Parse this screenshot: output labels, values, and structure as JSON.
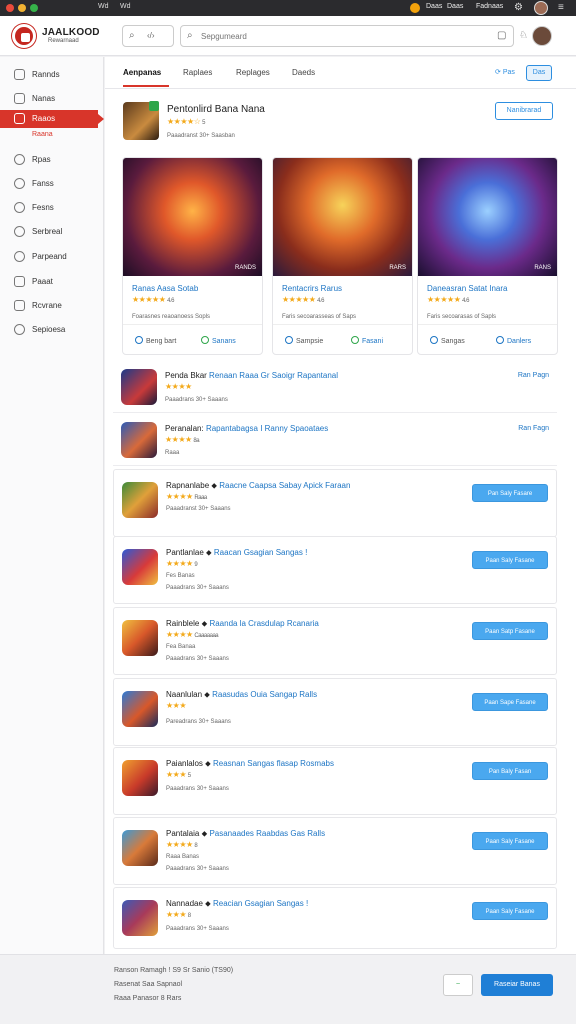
{
  "titlebar": {
    "menu": [
      "Wd",
      "Wd"
    ],
    "right": [
      "Daas",
      "Daas",
      "Fadnaas"
    ]
  },
  "header": {
    "logo_title": "JAALKOOD",
    "logo_sub": "Rewarnaad",
    "search_placeholder": "Sepgumeard"
  },
  "sidebar": {
    "items": [
      {
        "label": "Rannds"
      },
      {
        "label": "Nanas"
      },
      {
        "label": "Raaos",
        "active": true
      },
      {
        "label": "Rpas"
      },
      {
        "label": "Fanss"
      },
      {
        "label": "Fesns"
      },
      {
        "label": "Serbreal"
      },
      {
        "label": "Parpeand"
      },
      {
        "label": "Paaat"
      },
      {
        "label": "Rcvrane"
      },
      {
        "label": "Sepioesa"
      }
    ],
    "active_sub": "Raana"
  },
  "tabs": {
    "items": [
      "Aenpanas",
      "Raplaes",
      "Replages",
      "Daeds"
    ],
    "link": "Pas",
    "button": "Das"
  },
  "featured": {
    "title": "Pentonlird Bana Nana",
    "rating": "★★★★☆",
    "rating_text": "5",
    "meta": "Paaadranst 30+  Saasban",
    "button": "Nanibrarad"
  },
  "cards": [
    {
      "title": "Ranas Aasa Sotab",
      "rating": "★★★★★",
      "rating_text": "4.6",
      "meta": "Foarasnes reaoanoess Sopls",
      "img_tag": "RANDS",
      "act1": "Beng bart",
      "act2": "Sanans"
    },
    {
      "title": "Rentacrirs Rarus",
      "rating": "★★★★★",
      "rating_text": "4.6",
      "meta": "Faris secoarasseas of Saps",
      "img_tag": "RARS",
      "act1": "Sampsie",
      "act2": "Fasani"
    },
    {
      "title": "Daneasran Satat Inara",
      "rating": "★★★★★",
      "rating_text": "4.6",
      "meta": "Faris secoarasas of Sapls",
      "img_tag": "RANS",
      "act1": "Sangas",
      "act2": "Danlers"
    }
  ],
  "list": [
    {
      "title": "Penda Bkar",
      "accent": "Renaan Raaa Gr Saoigr Rapantanal",
      "rating": "★★★★",
      "meta1": "Paaadrans 30+  Saaans",
      "link": "Ran Pagn",
      "button": ""
    },
    {
      "title": "Peranalan:",
      "accent": "Rapantabagsa I Ranny Spaoataes",
      "rating": "★★★★",
      "rating_text": "8a",
      "meta1": "Raaa",
      "link": "Ran Fagn",
      "button": ""
    },
    {
      "title": "Rapnanlabe",
      "accent": "Raacne Caapsa Sabay Apick Faraan",
      "rating": "★★★★",
      "rating_text": "Raaa",
      "meta1": "Paaadranst 30+  Saaans",
      "button": "Pan Saly Fasare"
    },
    {
      "title": "Pantlanlae",
      "accent": "Raacan Gsagian Sangas !",
      "rating": "★★★★",
      "rating_text": "9",
      "meta1": "Fes Banas",
      "meta2": "Paaadrans 30+  Saaans",
      "button": "Paan Saly Fasane"
    },
    {
      "title": "Rainblele",
      "accent": "Raanda la Crasdulap Rcanaria",
      "rating": "★★★★",
      "rating_text": "Caaaaaaa",
      "meta1": "Fea Banaa",
      "meta2": "Paaadrans 30+  Saaans",
      "button": "Paan Satp Fasane"
    },
    {
      "title": "Naanlulan",
      "accent": "Raasudas Ouia Sangap Ralls",
      "rating": "★★★",
      "meta1": "Pareadrans 30+  Saaans",
      "button": "Paan Sape Fasane"
    },
    {
      "title": "Paianlalos",
      "accent": "Reasnan Sangas flasap Rosmabs",
      "rating": "★★★",
      "rating_text": "5",
      "meta1": "Paaadrans 30+  Saaans",
      "button": "Pan Baly Fasan"
    },
    {
      "title": "Pantalaia",
      "accent": "Pasanaades Raabdas Gas Ralls",
      "rating": "★★★★",
      "rating_text": "8",
      "meta1": "Raaa Banas",
      "meta2": "Paaadrans 30+  Saaans",
      "button": "Paan Saly Fasane"
    },
    {
      "title": "Nannadae",
      "accent": "Reacian Gsagian Sangas !",
      "rating": "★★★",
      "rating_text": "8",
      "meta1": "Paaadrans 30+  Saaans",
      "button": "Paan Saly Fasane"
    }
  ],
  "footer": {
    "line1": "Ranson Ramagh ! S9 Sr Sanio (TS90)",
    "line2": "Rasenat Saa Sapnaol",
    "line3": "Raaa Panasor 8 Rars",
    "small": "~",
    "button": "Raseiar Banas"
  },
  "colors": {
    "accent_red": "#d8352a",
    "link_blue": "#1d75c4",
    "button_blue": "#4aa8ef",
    "star": "#f3a91a"
  }
}
